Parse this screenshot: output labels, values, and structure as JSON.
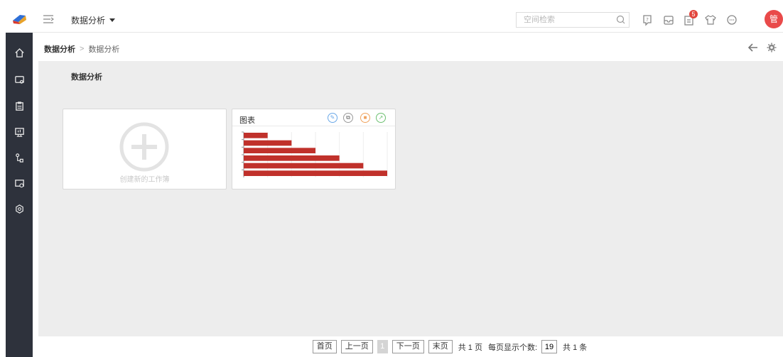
{
  "header": {
    "module_label": "数据分析",
    "search_placeholder": "空间检索",
    "notification_count": "5",
    "avatar_text": "管"
  },
  "breadcrumb": {
    "current": "数据分析",
    "separator": ">",
    "leaf": "数据分析"
  },
  "main": {
    "section_title": "数据分析",
    "new_card_label": "创建新的工作簿",
    "chart_card_title": "图表"
  },
  "chart_data": {
    "type": "bar",
    "orientation": "horizontal",
    "categories": [
      "",
      "",
      "",
      "",
      "",
      ""
    ],
    "values": [
      1,
      2,
      3,
      4,
      5,
      6
    ],
    "xlim": [
      0,
      6
    ],
    "color": "#c0312b",
    "grid": true
  },
  "pagination": {
    "first": "首页",
    "prev": "上一页",
    "current_page": "1",
    "next": "下一页",
    "last": "末页",
    "total_pages": "共 1 页",
    "page_size_label": "每页显示个数:",
    "page_size": "19",
    "total_items": "共 1 条"
  },
  "colors": {
    "sidebar_bg": "#2e323c",
    "avatar_bg": "#e94a4a",
    "badge_bg": "#e2453c",
    "content_bg": "#ededed",
    "bar_color": "#c0312b"
  },
  "icons": {
    "sidebar": [
      "home-icon",
      "monitor-icon",
      "clipboard-icon",
      "screen-icon",
      "flow-icon",
      "device-icon",
      "settings-icon"
    ],
    "header": [
      "help-icon",
      "inbox-icon",
      "notification-icon",
      "shirt-icon",
      "message-icon"
    ]
  }
}
